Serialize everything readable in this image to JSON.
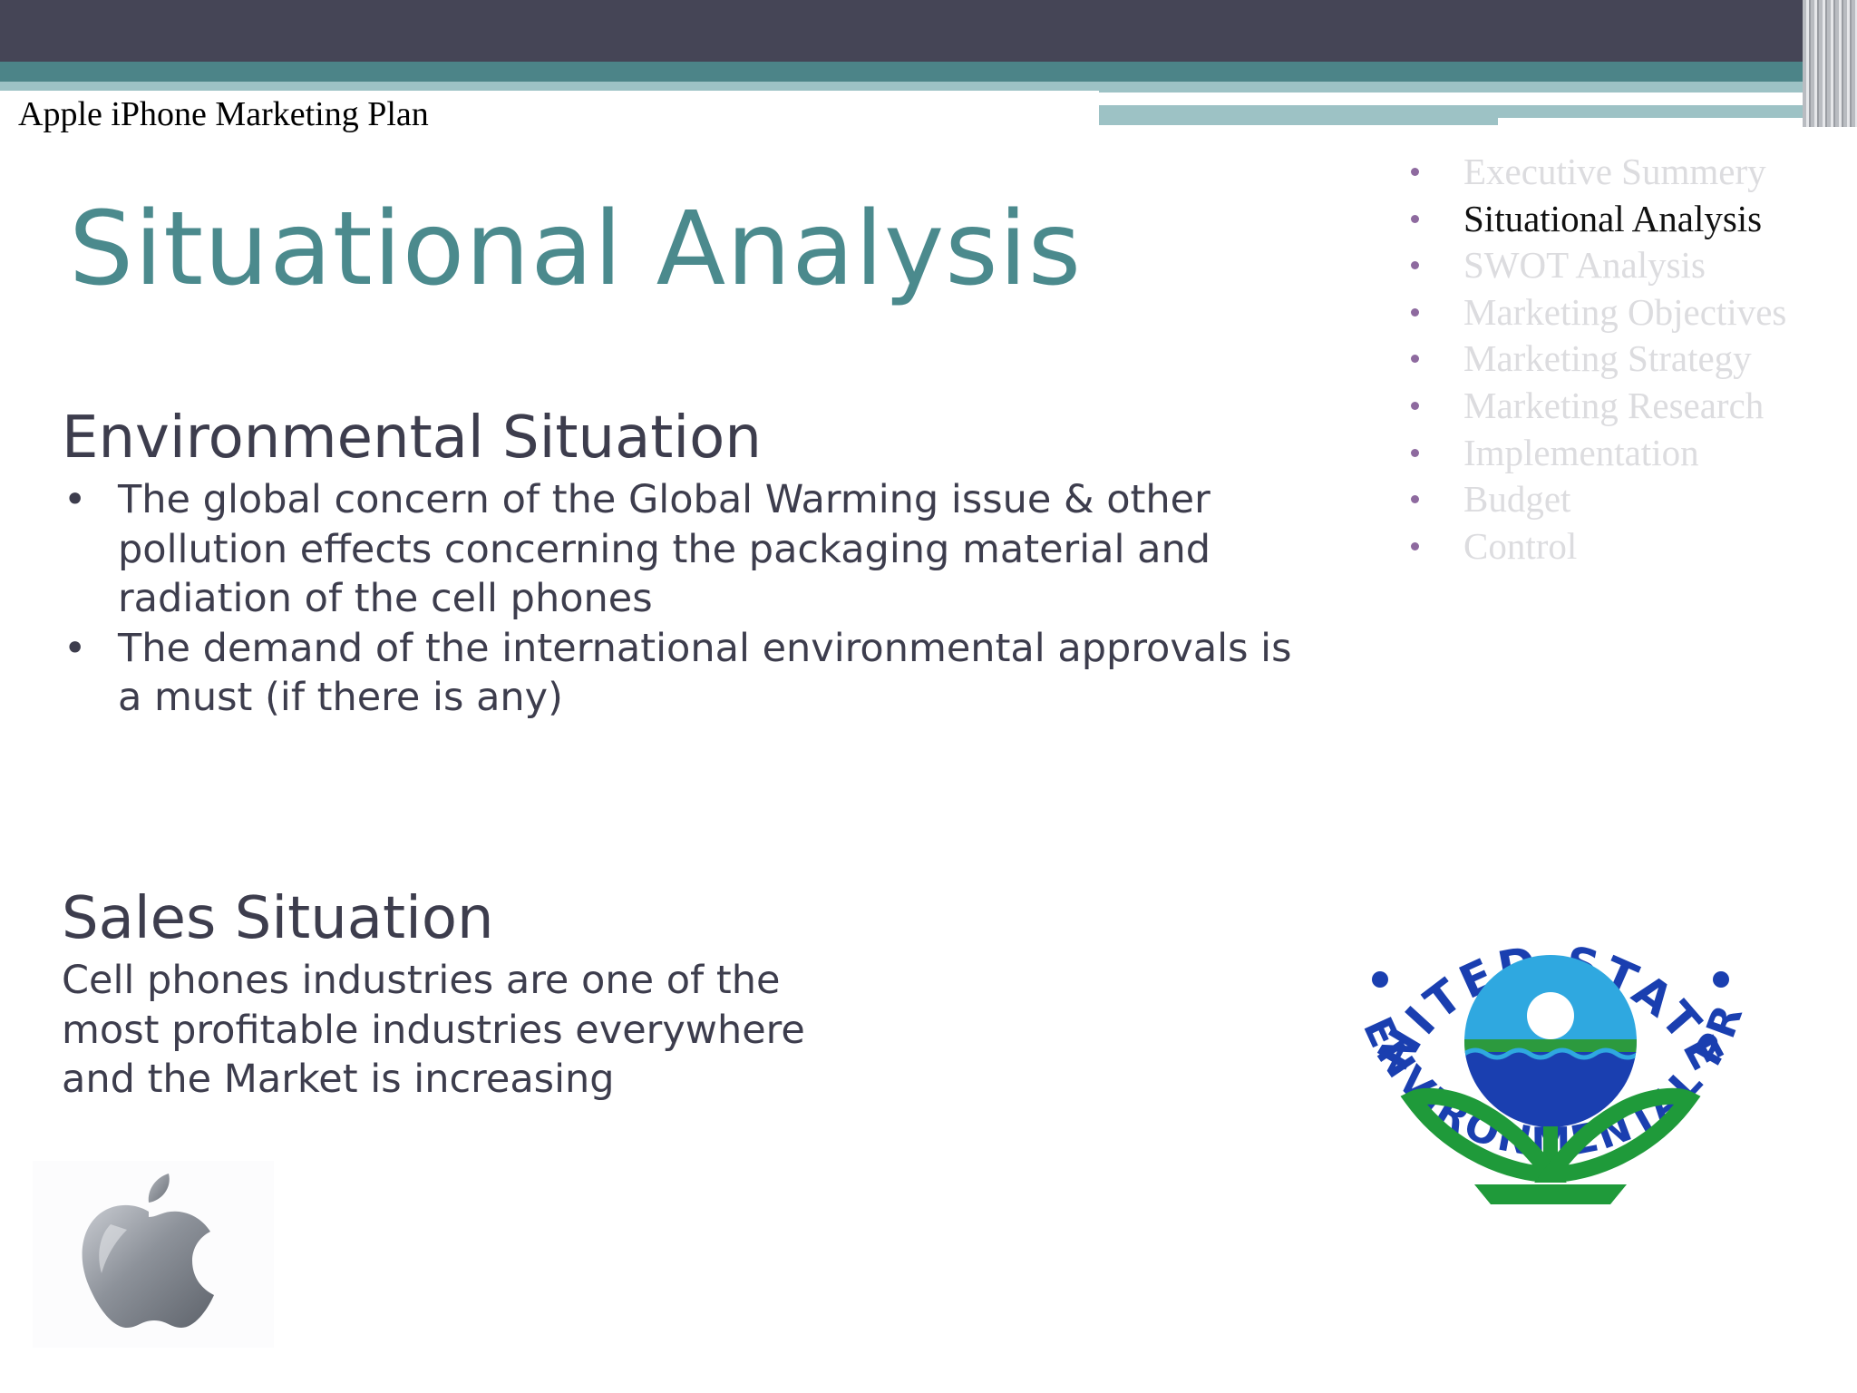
{
  "header": {
    "title": "Apple iPhone Marketing Plan"
  },
  "slide": {
    "title": "Situational Analysis",
    "environmental": {
      "heading": "Environmental Situation",
      "bullets": [
        "The global concern of the Global Warming issue & other pollution effects concerning the packaging material and radiation of the cell phones",
        "The demand of the international environmental approvals is a must (if there is any)"
      ]
    },
    "sales": {
      "heading": "Sales Situation",
      "text": "Cell phones industries are one of the most profitable industries everywhere and the Market is increasing"
    }
  },
  "nav": {
    "items": [
      {
        "label": "Executive Summery",
        "active": false
      },
      {
        "label": "Situational Analysis",
        "active": true
      },
      {
        "label": "SWOT Analysis",
        "active": false
      },
      {
        "label": "Marketing Objectives",
        "active": false
      },
      {
        "label": "Marketing Strategy",
        "active": false
      },
      {
        "label": "Marketing Research",
        "active": false
      },
      {
        "label": "Implementation",
        "active": false
      },
      {
        "label": "Budget",
        "active": false
      },
      {
        "label": "Control",
        "active": false
      }
    ]
  },
  "seal": {
    "top_text": "UNITED STATES",
    "left_text": "ENVIRONMENTAL",
    "bottom_text": "PROTECTION",
    "right_text": "AGENCY"
  },
  "images": {
    "apple_logo": "apple-logo-icon",
    "epa_seal": "epa-seal-icon"
  },
  "colors": {
    "title_teal": "#4b8a8d",
    "top_bar": "#454556",
    "accent_teal": "#4c8488",
    "light_teal": "#9dc2c5",
    "bullet_purple": "#8e6a9f",
    "seal_blue": "#1a3fb0",
    "seal_green": "#1f9a3a"
  }
}
